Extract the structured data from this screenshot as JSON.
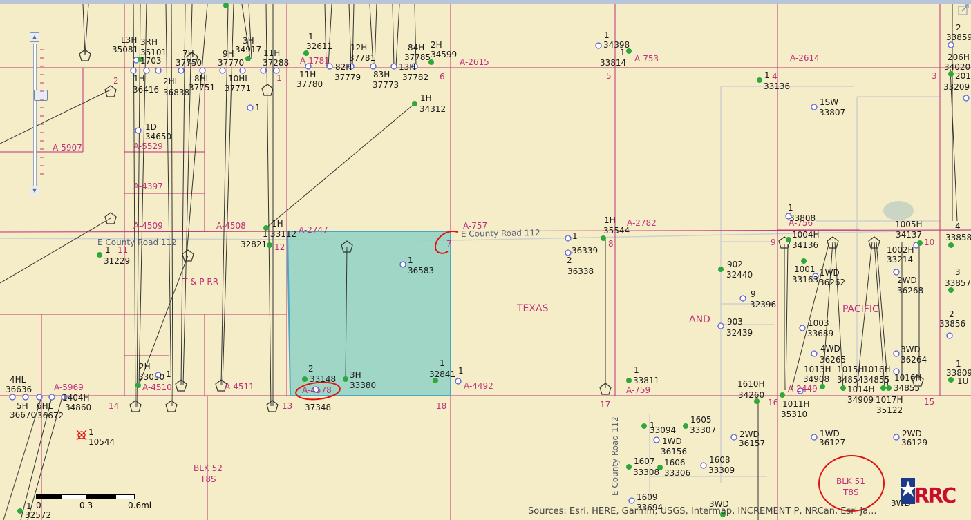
{
  "map": {
    "colors": {
      "land": "#f4edc7",
      "survey_line": "#c0307a",
      "road": "#cfcfcf",
      "lease_fill": "#8fd1c6",
      "lease_stroke": "#4aa6c6",
      "well_green": "#2ea83a",
      "well_permit": "#5860d8",
      "annotation_red": "#e21010",
      "well_bore": "#333333"
    },
    "section_numbers": [
      "2",
      "1",
      "6",
      "5",
      "4",
      "3",
      "7",
      "8",
      "9",
      "10",
      "11",
      "12",
      "13",
      "14",
      "15",
      "16",
      "17",
      "18"
    ],
    "abstracts": [
      "A-5907",
      "A-5529",
      "A-4397",
      "A-4509",
      "A-4508",
      "A-2747",
      "A-757",
      "A-2782",
      "A-756",
      "A-1781",
      "A-2615",
      "A-2614",
      "A-753",
      "A-5969",
      "A-4510",
      "A-4511",
      "A-4578",
      "A-4492",
      "A-759",
      "A-2449"
    ],
    "well_labels": [
      "L3H",
      "35081",
      "3RH",
      "35101",
      "1703",
      "7H",
      "37750",
      "3H",
      "34917",
      "9H",
      "37770",
      "11H",
      "37288",
      "1",
      "32611",
      "12H",
      "37781",
      "84H",
      "37785",
      "2H",
      "34599",
      "11H",
      "37780",
      "82H",
      "37779",
      "83H",
      "37773",
      "13H",
      "37782",
      "1H",
      "36416",
      "2HL",
      "36838",
      "8HL",
      "37751",
      "10HL",
      "37771",
      "1",
      "1H",
      "34312",
      "1D",
      "34650",
      "1H",
      "1",
      "33112",
      "32821",
      "1",
      "31229",
      "1",
      "36583",
      "1",
      "36339",
      "2",
      "36338",
      "1H",
      "35544",
      "1",
      "34398",
      "1",
      "33814",
      "1",
      "33136",
      "1SW",
      "33807",
      "2",
      "33859",
      "206H",
      "34020",
      "201",
      "33209",
      "1",
      "33808",
      "1004H",
      "34136",
      "1005H",
      "34137",
      "4",
      "33858",
      "902",
      "32440",
      "1001",
      "33163",
      "1WD",
      "36262",
      "1002H",
      "33214",
      "2WD",
      "36268",
      "3",
      "33857",
      "9",
      "32396",
      "903",
      "32439",
      "1003",
      "33689",
      "4WD",
      "36265",
      "3WD",
      "36264",
      "2",
      "33856",
      "1013H",
      "34908",
      "1015H",
      "34854",
      "1016H",
      "34855",
      "1016H",
      "34855",
      "1",
      "33809",
      "1U",
      "1014H",
      "34909",
      "1017H",
      "35122",
      "1011H",
      "35310",
      "1610H",
      "34260",
      "1",
      "33811",
      "2H",
      "33050",
      "1",
      "2",
      "33148",
      "3H",
      "33380",
      "37348",
      "1",
      "32841",
      "1",
      "4HL",
      "36636",
      "1404H",
      "34860",
      "5H",
      "36670",
      "6HL",
      "36672",
      "1",
      "10544",
      "1",
      "33094",
      "1605",
      "33307",
      "1WD",
      "36156",
      "2WD",
      "36157",
      "1WD",
      "36127",
      "2WD",
      "36129",
      "1607",
      "33308",
      "1606",
      "33306",
      "1608",
      "33309",
      "1609",
      "33694",
      "3WD",
      "3WD",
      "1",
      "32572"
    ],
    "place_labels": {
      "texas": "TEXAS",
      "and": "AND",
      "pacific": "PACIFIC",
      "tp_rr": "T & P RR",
      "blk52": "BLK 52",
      "t8s_a": "T8S",
      "blk51": "BLK 51",
      "t8s_b": "T8S"
    },
    "roads": {
      "county_road_112_west": "E County Road 112",
      "county_road_112_east": "E County Road 112",
      "county_road_112_vertical": "E County Road 112"
    }
  },
  "scale_bar": {
    "labels": [
      "0",
      "0.3",
      "0.6mi"
    ]
  },
  "attribution": "Sources: Esri, HERE, Garmin, USGS, Intermap, INCREMENT P, NRCan, Esri Ja...",
  "logo": {
    "text": "RRC"
  }
}
